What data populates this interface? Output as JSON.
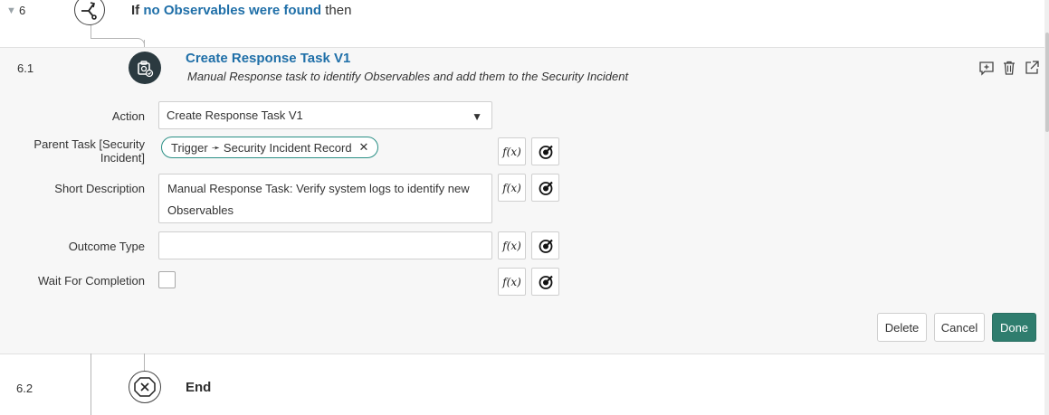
{
  "step6": {
    "number": "6",
    "if_keyword": "If",
    "condition": "no Observables were found",
    "then": "then"
  },
  "step61": {
    "number": "6.1",
    "title": "Create Response Task V1",
    "description": "Manual Response task to identify Observables and add them to the Security Incident",
    "icons": [
      "add-comment-icon",
      "trash-icon",
      "open-external-icon"
    ]
  },
  "form": {
    "action_label": "Action",
    "action_value": "Create Response Task V1",
    "parent_task_label_line1": "Parent Task [Security",
    "parent_task_label_line2": "Incident]",
    "parent_task_pill_1": "Trigger",
    "parent_task_pill_arrow": "➛",
    "parent_task_pill_2": "Security Incident Record",
    "parent_task_pill_remove": "✕",
    "short_description_label": "Short Description",
    "short_description_value": "Manual Response Task: Verify system logs to identify new Observables",
    "outcome_type_label": "Outcome Type",
    "outcome_type_value": "",
    "wait_for_completion_label": "Wait For Completion",
    "wait_for_completion_checked": false,
    "fx_label": "f(x)"
  },
  "footer": {
    "delete_label": "Delete",
    "cancel_label": "Cancel",
    "done_label": "Done"
  },
  "step62": {
    "number": "6.2",
    "title": "End"
  },
  "colors": {
    "link": "#1f6fa8",
    "accent": "#2f7d6e",
    "pill_border": "#2a8f85",
    "dark_icon_bg": "#2b3a40"
  }
}
